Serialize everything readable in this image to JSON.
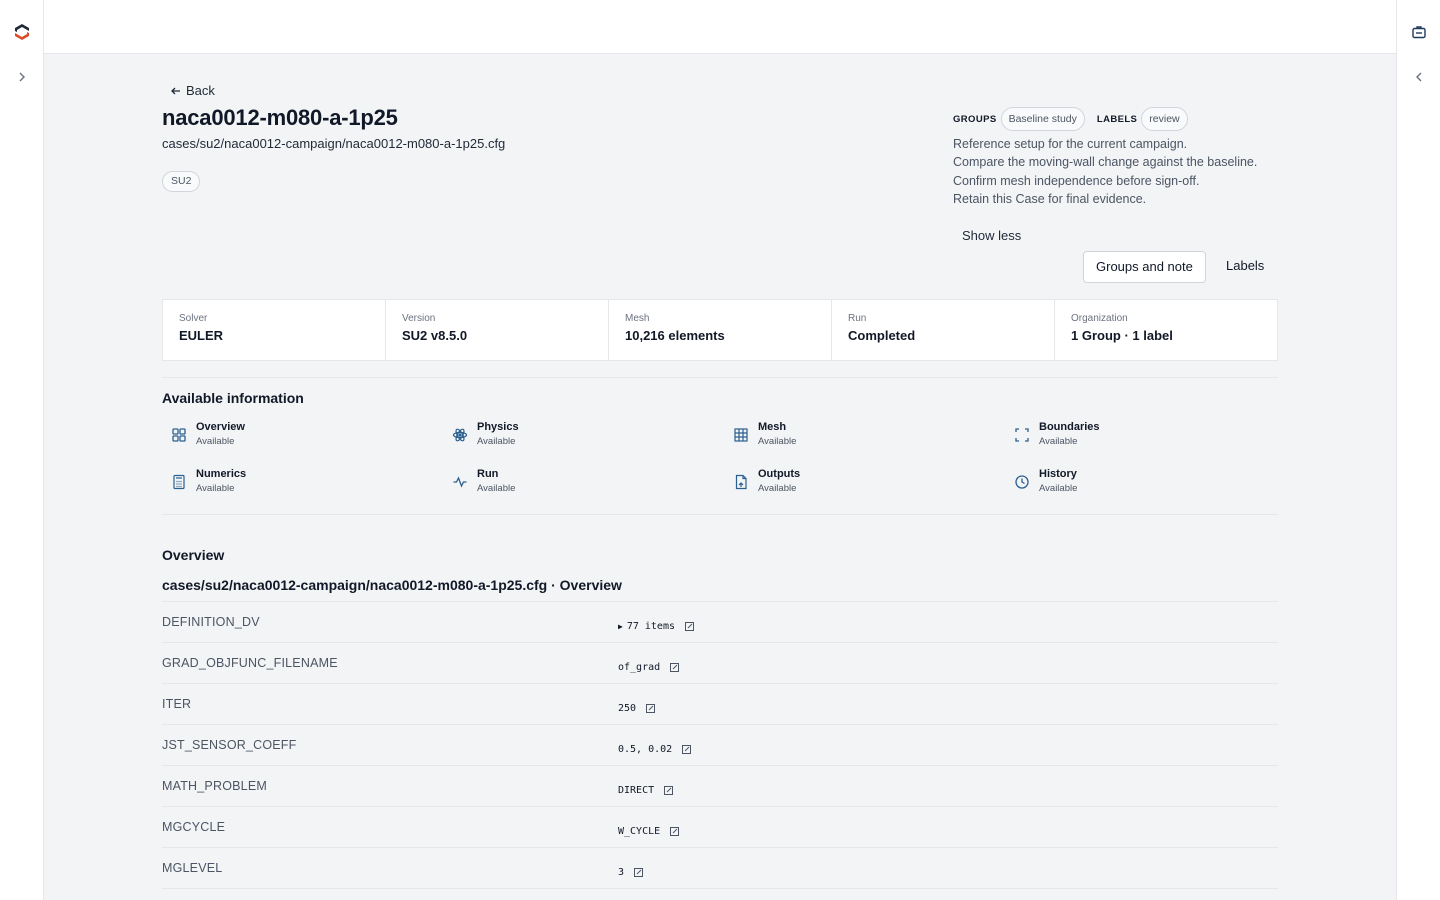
{
  "nav": {
    "back_label": "Back"
  },
  "case": {
    "title": "naca0012-m080-a-1p25",
    "path": "cases/su2/naca0012-campaign/naca0012-m080-a-1p25.cfg",
    "solver_chip": "SU2"
  },
  "meta": {
    "groups_label": "GROUPS",
    "group_chip": "Baseline study",
    "labels_label": "LABELS",
    "label_chip": "review"
  },
  "note_lines": [
    "Reference setup for the current campaign.",
    "Compare the moving-wall change against the baseline.",
    "Confirm mesh independence before sign-off.",
    "Retain this Case for final evidence."
  ],
  "actions": {
    "show_less": "Show less",
    "groups_and_note": "Groups and note",
    "labels": "Labels"
  },
  "stats": [
    {
      "label": "Solver",
      "value": "EULER"
    },
    {
      "label": "Version",
      "value": "SU2 v8.5.0"
    },
    {
      "label": "Mesh",
      "value": "10,216 elements"
    },
    {
      "label": "Run",
      "value": "Completed"
    },
    {
      "label": "Organization",
      "value": "1 Group · 1 label"
    }
  ],
  "available": {
    "title": "Available information",
    "items": [
      {
        "name": "Overview",
        "status": "Available",
        "icon": "grid-icon"
      },
      {
        "name": "Physics",
        "status": "Available",
        "icon": "atom-icon"
      },
      {
        "name": "Mesh",
        "status": "Available",
        "icon": "mesh-icon"
      },
      {
        "name": "Boundaries",
        "status": "Available",
        "icon": "boundaries-icon"
      },
      {
        "name": "Numerics",
        "status": "Available",
        "icon": "calculator-icon"
      },
      {
        "name": "Run",
        "status": "Available",
        "icon": "activity-icon"
      },
      {
        "name": "Outputs",
        "status": "Available",
        "icon": "file-icon"
      },
      {
        "name": "History",
        "status": "Available",
        "icon": "clock-icon"
      }
    ]
  },
  "overview": {
    "title": "Overview",
    "subtitle": "cases/su2/naca0012-campaign/naca0012-m080-a-1p25.cfg · Overview",
    "rows": [
      {
        "key": "DEFINITION_DV",
        "value": "77 items",
        "expandable": true
      },
      {
        "key": "GRAD_OBJFUNC_FILENAME",
        "value": "of_grad",
        "expandable": false
      },
      {
        "key": "ITER",
        "value": "250",
        "expandable": false
      },
      {
        "key": "JST_SENSOR_COEFF",
        "value": "0.5, 0.02",
        "expandable": false
      },
      {
        "key": "MATH_PROBLEM",
        "value": "DIRECT",
        "expandable": false
      },
      {
        "key": "MGCYCLE",
        "value": "W_CYCLE",
        "expandable": false
      },
      {
        "key": "MGLEVEL",
        "value": "3",
        "expandable": false
      }
    ]
  },
  "colors": {
    "accent": "#2b5f8f",
    "logo_dark": "#1f2937",
    "logo_red": "#dc4a2a"
  }
}
